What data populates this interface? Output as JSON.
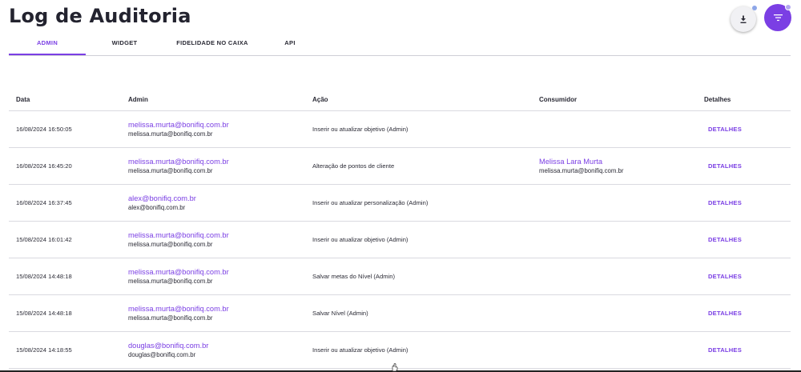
{
  "page": {
    "title": "Log de Auditoria"
  },
  "actions": {
    "download_icon": "download-icon",
    "filter_icon": "filter-icon"
  },
  "colors": {
    "accent": "#7b3fe4",
    "text": "#23232f",
    "divider": "#dadae0"
  },
  "tabs": [
    {
      "label": "ADMIN",
      "active": true
    },
    {
      "label": "WIDGET",
      "active": false
    },
    {
      "label": "FIDELIDADE NO CAIXA",
      "active": false
    },
    {
      "label": "API",
      "active": false
    }
  ],
  "table": {
    "headers": {
      "date": "Data",
      "admin": "Admin",
      "action": "Ação",
      "consumer": "Consumidor",
      "details": "Detalhes"
    },
    "rows": [
      {
        "date": "16/08/2024 16:50:05",
        "admin_link": "melissa.murta@bonifiq.com.br",
        "admin_email": "melissa.murta@bonifiq.com.br",
        "action": "Inserir ou atualizar objetivo (Admin)",
        "consumer_name": "",
        "consumer_email": "",
        "details": "DETALHES"
      },
      {
        "date": "16/08/2024 16:45:20",
        "admin_link": "melissa.murta@bonifiq.com.br",
        "admin_email": "melissa.murta@bonifiq.com.br",
        "action": "Alteração de pontos de cliente",
        "consumer_name": "Melissa Lara Murta",
        "consumer_email": "melissa.murta@bonifiq.com.br",
        "details": "DETALHES"
      },
      {
        "date": "16/08/2024 16:37:45",
        "admin_link": "alex@bonifiq.com.br",
        "admin_email": "alex@bonifiq.com.br",
        "action": "Inserir ou atualizar personalização (Admin)",
        "consumer_name": "",
        "consumer_email": "",
        "details": "DETALHES"
      },
      {
        "date": "15/08/2024 16:01:42",
        "admin_link": "melissa.murta@bonifiq.com.br",
        "admin_email": "melissa.murta@bonifiq.com.br",
        "action": "Inserir ou atualizar objetivo (Admin)",
        "consumer_name": "",
        "consumer_email": "",
        "details": "DETALHES"
      },
      {
        "date": "15/08/2024 14:48:18",
        "admin_link": "melissa.murta@bonifiq.com.br",
        "admin_email": "melissa.murta@bonifiq.com.br",
        "action": "Salvar metas do Nível (Admin)",
        "consumer_name": "",
        "consumer_email": "",
        "details": "DETALHES"
      },
      {
        "date": "15/08/2024 14:48:18",
        "admin_link": "melissa.murta@bonifiq.com.br",
        "admin_email": "melissa.murta@bonifiq.com.br",
        "action": "Salvar Nível (Admin)",
        "consumer_name": "",
        "consumer_email": "",
        "details": "DETALHES"
      },
      {
        "date": "15/08/2024 14:18:55",
        "admin_link": "douglas@bonifiq.com.br",
        "admin_email": "douglas@bonifiq.com.br",
        "action": "Inserir ou atualizar objetivo (Admin)",
        "consumer_name": "",
        "consumer_email": "",
        "details": "DETALHES"
      }
    ]
  }
}
